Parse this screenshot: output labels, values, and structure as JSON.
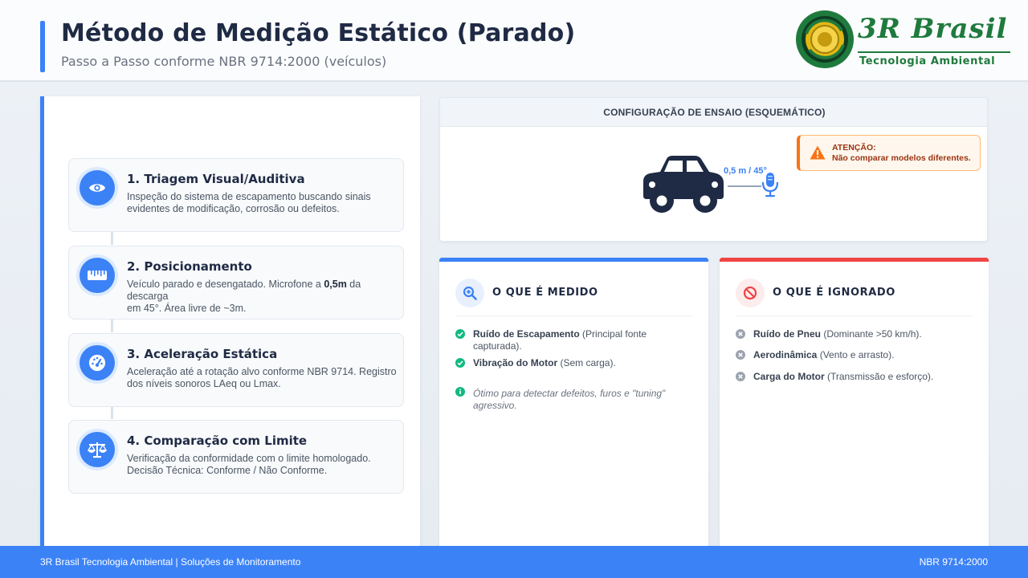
{
  "header": {
    "title": "Método de Medição Estático (Parado)",
    "subtitle": "Passo a Passo conforme NBR 9714:2000 (veículos)",
    "logo_brand": "3R Brasil",
    "logo_tagline": "Tecnologia Ambiental"
  },
  "steps": [
    {
      "icon": "eye-icon",
      "title": "1. Triagem Visual/Auditiva",
      "line1": "Inspeção do sistema de escapamento buscando sinais",
      "line2": "evidentes de modificação, corrosão ou defeitos."
    },
    {
      "icon": "ruler-icon",
      "title": "2. Posicionamento",
      "line1_pre": "Veículo parado e desengatado. Microfone a ",
      "line1_bold": "0,5m",
      "line1_post": " da descarga",
      "line2": "em 45°. Área livre de ~3m."
    },
    {
      "icon": "gauge-icon",
      "title": "3. Aceleração Estática",
      "line1": "Aceleração até a rotação alvo conforme NBR 9714. Registro",
      "line2": "dos níveis sonoros LAeq ou Lmax."
    },
    {
      "icon": "balance-scale-icon",
      "title": "4. Comparação com Limite",
      "line1": "Verificação da conformidade com o limite homologado.",
      "line2": "Decisão Técnica: Conforme / Não Conforme."
    }
  ],
  "config": {
    "heading": "CONFIGURAÇÃO DE ENSAIO (ESQUEMÁTICO)",
    "distance_label": "0,5 m / 45°",
    "warning_title": "ATENÇÃO:",
    "warning_text": "Não comparar modelos diferentes."
  },
  "measured": {
    "title": "O QUE É MEDIDO",
    "items": [
      {
        "bold": "Ruído de Escapamento",
        "rest": " (Principal fonte capturada)."
      },
      {
        "bold": "Vibração do Motor",
        "rest": " (Sem carga)."
      }
    ],
    "note_line1": "Ótimo para detectar defeitos, furos e \"tuning\"",
    "note_line2": "agressivo."
  },
  "ignored": {
    "title": "O QUE É IGNORADO",
    "items": [
      {
        "bold": "Ruído de Pneu",
        "rest": " (Dominante >50 km/h)."
      },
      {
        "bold": "Aerodinâmica",
        "rest": " (Vento e arrasto)."
      },
      {
        "bold": "Carga do Motor",
        "rest": " (Transmissão e esforço)."
      }
    ]
  },
  "footer": {
    "left": "3R Brasil Tecnologia Ambiental | Soluções de Monitoramento",
    "right": "NBR 9714:2000"
  },
  "colors": {
    "primary": "#3b82f6",
    "ignored_accent": "#ef4444",
    "check_green": "#10b981",
    "warning_orange": "#f97316",
    "brand_green": "#1f7a3d"
  }
}
